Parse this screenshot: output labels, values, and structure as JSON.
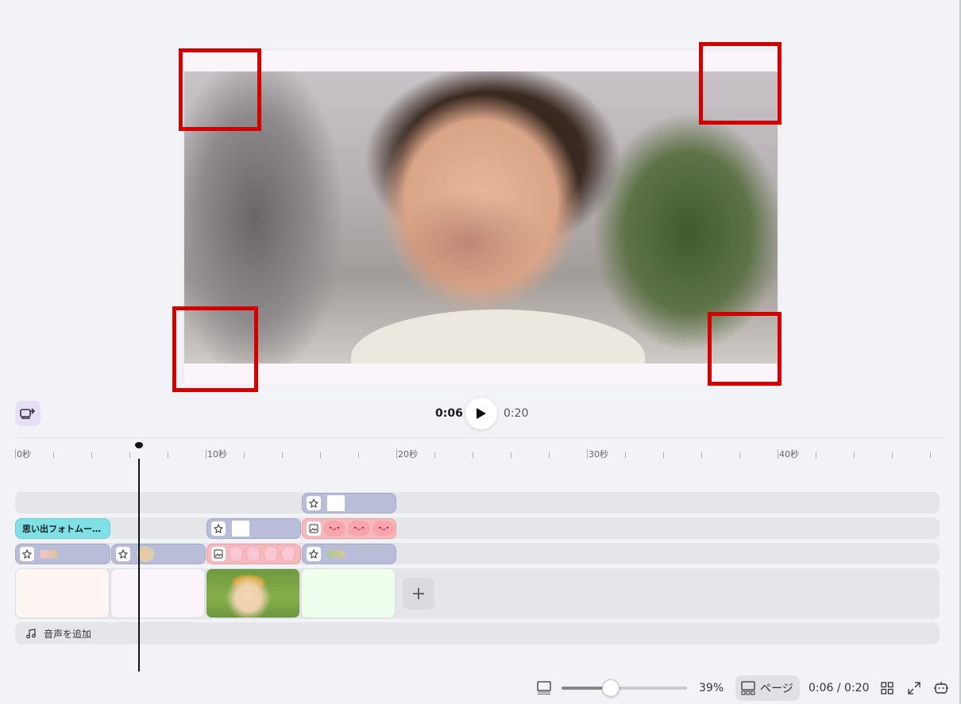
{
  "player": {
    "current_time": "0:06",
    "total_time": "0:20"
  },
  "ruler": {
    "labels": [
      "0秒",
      "10秒",
      "20秒",
      "30秒",
      "40秒"
    ]
  },
  "tracks": {
    "title_clip": "思い出フォトムー…",
    "add_audio": "音声を追加"
  },
  "footer": {
    "zoom": "39%",
    "zoom_fraction": 0.39,
    "page_label": "ページ",
    "time": "0:06 / 0:20"
  },
  "colors": {
    "highlight_box": "#d40000",
    "title_clip": "#7fe1e6",
    "element_clip": "#b9bdd8",
    "image_clip": "#f6b9bd"
  },
  "icons": [
    "slideshow-toggle-icon",
    "play-icon",
    "sticker-icon",
    "image-icon",
    "plus-icon",
    "music-note-icon",
    "grid-view-icon",
    "fullscreen-icon",
    "assistant-icon",
    "timeline-layout-icon",
    "page-layout-icon"
  ]
}
